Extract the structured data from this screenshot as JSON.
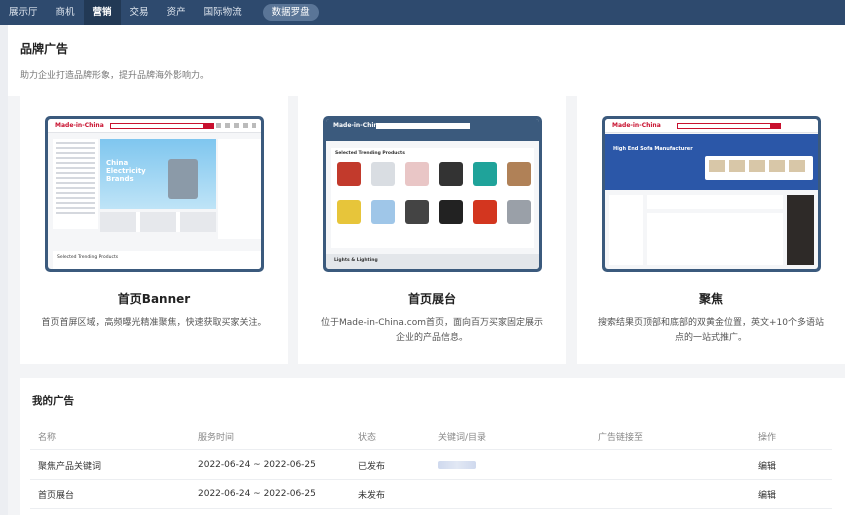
{
  "nav": {
    "items": [
      "展示厅",
      "商机",
      "营销",
      "交易",
      "资产",
      "国际物流"
    ],
    "active": "营销",
    "pill": "数据罗盘"
  },
  "brand": {
    "title": "品牌广告",
    "subtitle": "助力企业打造品牌形象，提升品牌海外影响力。"
  },
  "cards": [
    {
      "title": "首页Banner",
      "desc": "首页首屏区域，高频曝光精准聚焦，快速获取买家关注。",
      "preview": {
        "logo": "Made-in-China",
        "banner_text": "China Electricity Brands",
        "section": "Selected Trending Products"
      }
    },
    {
      "title": "首页展台",
      "desc": "位于Made-in-China.com首页，面向百万买家固定展示企业的产品信息。",
      "preview": {
        "logo": "Made-in-China",
        "section": "Selected Trending Products",
        "bottom": "Lights & Lighting"
      }
    },
    {
      "title": "聚焦",
      "desc": "搜索结果页顶部和底部的双黄金位置，英文+10个多语站点的一站式推广。",
      "preview": {
        "logo": "Made-in-China",
        "banner_text": "High End Sofa Manufacturer"
      }
    }
  ],
  "my_ads": {
    "title": "我的广告",
    "columns": {
      "name": "名称",
      "time": "服务时间",
      "status": "状态",
      "keyword": "关键词/目录",
      "link": "广告链接至",
      "op": "操作"
    },
    "rows": [
      {
        "name": "聚焦产品关键词",
        "time": "2022-06-24 ~ 2022-06-25",
        "status": "已发布",
        "keyword": "",
        "link": "",
        "op": "编辑"
      },
      {
        "name": "首页展台",
        "time": "2022-06-24 ~ 2022-06-25",
        "status": "未发布",
        "keyword": "",
        "link": "",
        "op": "编辑"
      }
    ]
  },
  "colors": {
    "nav_bg": "#2e4a6e",
    "accent": "#3d7fd8",
    "brand_red": "#c8102e"
  }
}
